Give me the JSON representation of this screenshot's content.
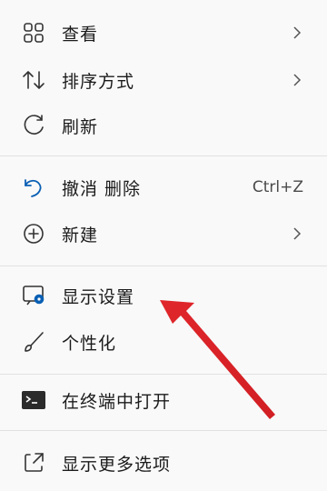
{
  "menu": {
    "items": [
      {
        "label": "查看",
        "icon": "grid-icon",
        "submenu": true
      },
      {
        "label": "排序方式",
        "icon": "sort-icon",
        "submenu": true
      },
      {
        "label": "刷新",
        "icon": "refresh-icon",
        "submenu": false
      },
      {
        "label": "撤消 删除",
        "icon": "undo-icon",
        "submenu": false,
        "shortcut": "Ctrl+Z"
      },
      {
        "label": "新建",
        "icon": "new-icon",
        "submenu": true
      },
      {
        "label": "显示设置",
        "icon": "display-settings-icon",
        "submenu": false
      },
      {
        "label": "个性化",
        "icon": "brush-icon",
        "submenu": false
      },
      {
        "label": "在终端中打开",
        "icon": "terminal-icon",
        "submenu": false
      },
      {
        "label": "显示更多选项",
        "icon": "more-options-icon",
        "submenu": false
      }
    ]
  },
  "annotation": {
    "arrow_color": "#e0262b",
    "accent_color": "#0a5fb4"
  }
}
